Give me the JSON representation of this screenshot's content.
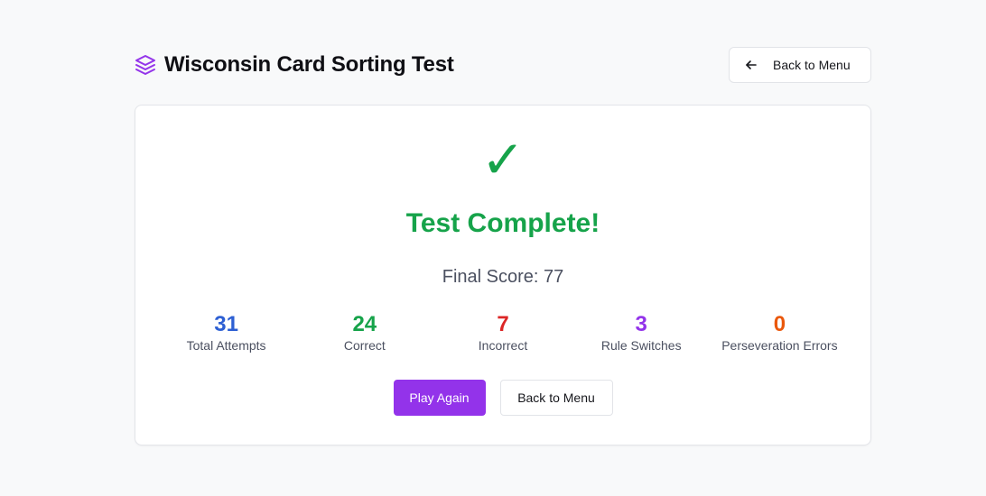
{
  "header": {
    "title": "Wisconsin Card Sorting Test",
    "logo_icon": "layers-icon",
    "back_button": {
      "label": "Back to Menu",
      "icon": "arrow-left-icon"
    }
  },
  "result": {
    "check_glyph": "✓",
    "heading": "Test Complete!",
    "score_text": "Final Score: 77"
  },
  "stats": [
    {
      "value": "31",
      "label": "Total Attempts",
      "color": "#2d5fd3"
    },
    {
      "value": "24",
      "label": "Correct",
      "color": "#16a34a"
    },
    {
      "value": "7",
      "label": "Incorrect",
      "color": "#dc2626"
    },
    {
      "value": "3",
      "label": "Rule Switches",
      "color": "#9333ea"
    },
    {
      "value": "0",
      "label": "Perseveration Errors",
      "color": "#ea580c"
    }
  ],
  "actions": {
    "play_again": "Play Again",
    "back_to_menu": "Back to Menu"
  },
  "colors": {
    "accent": "#9333ea",
    "success": "#16a34a",
    "background": "#f8f9fa"
  }
}
